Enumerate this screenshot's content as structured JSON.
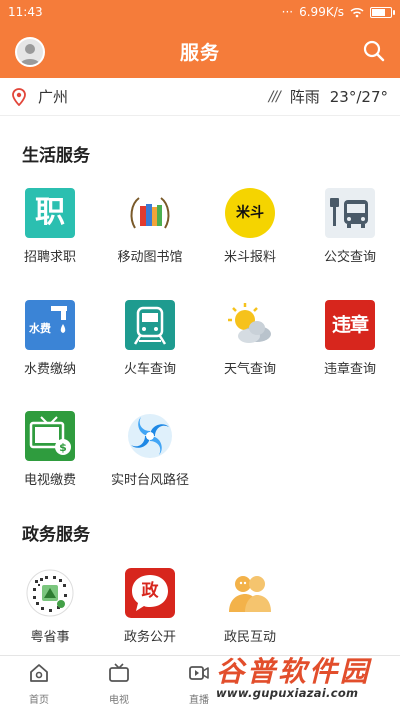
{
  "status": {
    "time": "11:43",
    "network_speed": "6.99K/s",
    "battery_level": 0.75
  },
  "header": {
    "title": "服务",
    "avatar_icon": "user-avatar-icon",
    "search_icon": "search-icon"
  },
  "weather": {
    "city": "广州",
    "condition": "阵雨",
    "temperature": "23°/27°",
    "rain_symbol": "///"
  },
  "sections": {
    "life": {
      "title": "生活服务",
      "items": [
        {
          "label": "招聘求职",
          "icon": "recruit-icon",
          "tile_text": "职",
          "color": "#2bbfb0"
        },
        {
          "label": "移动图书馆",
          "icon": "library-icon",
          "color": "#f0f0f0"
        },
        {
          "label": "米斗报料",
          "icon": "midou-icon",
          "tile_text": "米斗",
          "color": "#f5d400"
        },
        {
          "label": "公交查询",
          "icon": "bus-icon",
          "color": "#e9eef2"
        },
        {
          "label": "水费缴纳",
          "icon": "water-bill-icon",
          "tile_text": "水费",
          "color": "#3b84d6"
        },
        {
          "label": "火车查询",
          "icon": "train-icon",
          "color": "#1e9b8f"
        },
        {
          "label": "天气查询",
          "icon": "weather-icon",
          "color": "#ffffff"
        },
        {
          "label": "违章查询",
          "icon": "violation-icon",
          "tile_text": "违章",
          "color": "#d7261d"
        },
        {
          "label": "电视缴费",
          "icon": "tv-bill-icon",
          "color": "#2f9c3e"
        },
        {
          "label": "实时台风路径",
          "icon": "typhoon-icon",
          "color": "#ffffff"
        }
      ]
    },
    "gov": {
      "title": "政务服务",
      "items": [
        {
          "label": "粤省事",
          "icon": "yueshengshi-qr-icon",
          "color": "#ffffff"
        },
        {
          "label": "政务公开",
          "icon": "gov-open-icon",
          "tile_text": "政",
          "color": "#d7261d"
        },
        {
          "label": "政民互动",
          "icon": "interaction-icon",
          "color": "#f3b24a"
        }
      ]
    }
  },
  "bottom_nav": [
    {
      "label": "首页",
      "icon": "home-icon"
    },
    {
      "label": "电视",
      "icon": "tv-icon"
    },
    {
      "label": "直播",
      "icon": "live-icon"
    }
  ],
  "watermark": {
    "brand": "谷普软件园",
    "url": "www.gupuxiazai.com"
  }
}
